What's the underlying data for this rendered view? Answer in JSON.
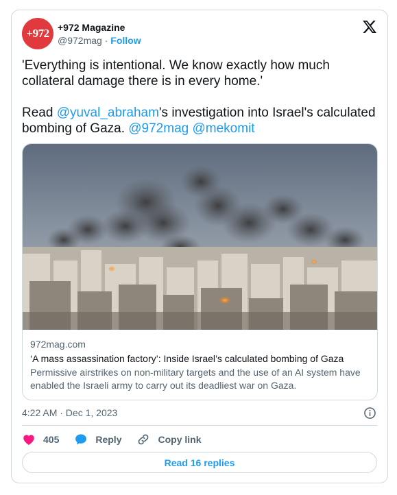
{
  "author": {
    "display_name": "+972 Magazine",
    "handle": "@972mag",
    "separator": "·",
    "follow_label": "Follow",
    "avatar_text": "+972"
  },
  "tweet": {
    "quote": "'Everything is intentional. We know exactly how much collateral damage there is in every home.'",
    "read_prefix": "Read ",
    "mention_1": "@yuval_abraham",
    "middle_text": "'s investigation into Israel's calculated bombing of Gaza. ",
    "mention_2": "@972mag",
    "mention_3": "@mekomit"
  },
  "link_card": {
    "domain": "972mag.com",
    "title": "‘A mass assassination factory’: Inside Israel’s calculated bombing of Gaza",
    "description": "Permissive airstrikes on non-military targets and the use of an AI system have enabled the Israeli army to carry out its deadliest war on Gaza."
  },
  "meta": {
    "timestamp": "4:22 AM · Dec 1, 2023"
  },
  "actions": {
    "like_count": "405",
    "reply_label": "Reply",
    "copy_link_label": "Copy link"
  },
  "footer": {
    "read_replies_label": "Read 16 replies"
  },
  "colors": {
    "accent": "#1d9bf0",
    "like": "#f91880",
    "avatar_bg": "#e03a3e"
  },
  "icons": [
    "x-logo-icon",
    "info-icon",
    "heart-icon",
    "reply-bubble-icon",
    "link-icon"
  ]
}
